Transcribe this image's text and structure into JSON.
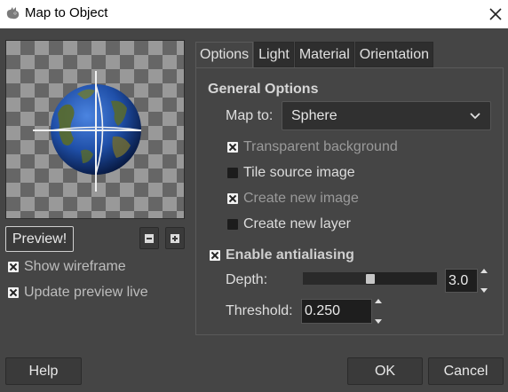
{
  "window": {
    "title": "Map to Object",
    "app_icon": "gimp-wilber-icon",
    "close_icon": "close-icon"
  },
  "preview": {
    "button_label": "Preview!",
    "zoom_out_icon": "zoom-out-icon",
    "zoom_in_icon": "zoom-in-icon",
    "show_wireframe": {
      "label": "Show wireframe",
      "checked": true
    },
    "update_live": {
      "label": "Update preview live",
      "checked": true
    }
  },
  "tabs": [
    {
      "label": "Options",
      "active": true
    },
    {
      "label": "Light",
      "active": false
    },
    {
      "label": "Material",
      "active": false
    },
    {
      "label": "Orientation",
      "active": false
    }
  ],
  "options": {
    "section_title": "General Options",
    "map_to_label": "Map to:",
    "map_to_value": "Sphere",
    "transparent_background": {
      "label": "Transparent background",
      "checked": true,
      "enabled": false
    },
    "tile_source_image": {
      "label": "Tile source image",
      "checked": false,
      "enabled": true
    },
    "create_new_image": {
      "label": "Create new image",
      "checked": true,
      "enabled": false
    },
    "create_new_layer": {
      "label": "Create new layer",
      "checked": false,
      "enabled": true
    },
    "antialiasing": {
      "label": "Enable antialiasing",
      "checked": true
    },
    "depth_label": "Depth:",
    "depth_value": "3.0",
    "depth_min": 1,
    "depth_max": 5,
    "threshold_label": "Threshold:",
    "threshold_value": "0.250"
  },
  "footer": {
    "help_label": "Help",
    "ok_label": "OK",
    "cancel_label": "Cancel"
  },
  "colors": {
    "background": "#454545",
    "titlebar": "#ffffff",
    "globe_ocean": "#1f4fa8",
    "globe_land": "#5a6b2a"
  }
}
